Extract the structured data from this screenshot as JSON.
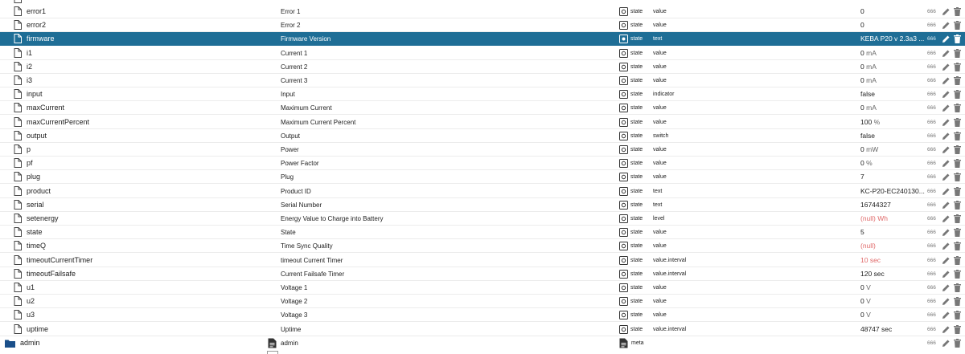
{
  "rows": [
    {
      "name": "error1",
      "label": "Error 1",
      "role": "state",
      "type": "value",
      "value": "0",
      "unit": "",
      "acl": "666"
    },
    {
      "name": "error2",
      "label": "Error 2",
      "role": "state",
      "type": "value",
      "value": "0",
      "unit": "",
      "acl": "666"
    },
    {
      "name": "firmware",
      "label": "Firmware Version",
      "role": "state",
      "type": "text",
      "value": "KEBA P20 v 2.3a3 ...",
      "unit": "",
      "acl": "666",
      "selected": true
    },
    {
      "name": "i1",
      "label": "Current 1",
      "role": "state",
      "type": "value",
      "value": "0",
      "unit": "mA",
      "acl": "666"
    },
    {
      "name": "i2",
      "label": "Current 2",
      "role": "state",
      "type": "value",
      "value": "0",
      "unit": "mA",
      "acl": "666"
    },
    {
      "name": "i3",
      "label": "Current 3",
      "role": "state",
      "type": "value",
      "value": "0",
      "unit": "mA",
      "acl": "666"
    },
    {
      "name": "input",
      "label": "Input",
      "role": "state",
      "type": "indicator",
      "value": "false",
      "unit": "",
      "acl": "666"
    },
    {
      "name": "maxCurrent",
      "label": "Maximum Current",
      "role": "state",
      "type": "value",
      "value": "0",
      "unit": "mA",
      "acl": "666"
    },
    {
      "name": "maxCurrentPercent",
      "label": "Maximum Current Percent",
      "role": "state",
      "type": "value",
      "value": "100",
      "unit": "%",
      "acl": "666"
    },
    {
      "name": "output",
      "label": "Output",
      "role": "state",
      "type": "switch",
      "value": "false",
      "unit": "",
      "acl": "666"
    },
    {
      "name": "p",
      "label": "Power",
      "role": "state",
      "type": "value",
      "value": "0",
      "unit": "mW",
      "acl": "666"
    },
    {
      "name": "pf",
      "label": "Power Factor",
      "role": "state",
      "type": "value",
      "value": "0",
      "unit": "%",
      "acl": "666"
    },
    {
      "name": "plug",
      "label": "Plug",
      "role": "state",
      "type": "value",
      "value": "7",
      "unit": "",
      "acl": "666"
    },
    {
      "name": "product",
      "label": "Product ID",
      "role": "state",
      "type": "text",
      "value": "KC-P20-EC240130...",
      "unit": "",
      "acl": "666"
    },
    {
      "name": "serial",
      "label": "Serial Number",
      "role": "state",
      "type": "text",
      "value": "16744327",
      "unit": "",
      "acl": "666"
    },
    {
      "name": "setenergy",
      "label": "Energy Value to Charge into Battery",
      "role": "state",
      "type": "level",
      "value": "(null) Wh",
      "unit": "",
      "acl": "666",
      "red": true
    },
    {
      "name": "state",
      "label": "State",
      "role": "state",
      "type": "value",
      "value": "5",
      "unit": "",
      "acl": "666"
    },
    {
      "name": "timeQ",
      "label": "Time Sync Quality",
      "role": "state",
      "type": "value",
      "value": "(null)",
      "unit": "",
      "acl": "666",
      "red": true
    },
    {
      "name": "timeoutCurrentTimer",
      "label": "timeout Current Timer",
      "role": "state",
      "type": "value.interval",
      "value": "10 sec",
      "unit": "",
      "acl": "666",
      "red": true
    },
    {
      "name": "timeoutFailsafe",
      "label": "Current Failsafe Timer",
      "role": "state",
      "type": "value.interval",
      "value": "120 sec",
      "unit": "",
      "acl": "666"
    },
    {
      "name": "u1",
      "label": "Voltage 1",
      "role": "state",
      "type": "value",
      "value": "0",
      "unit": "V",
      "acl": "666"
    },
    {
      "name": "u2",
      "label": "Voltage 2",
      "role": "state",
      "type": "value",
      "value": "0",
      "unit": "V",
      "acl": "666"
    },
    {
      "name": "u3",
      "label": "Voltage 3",
      "role": "state",
      "type": "value",
      "value": "0",
      "unit": "V",
      "acl": "666"
    },
    {
      "name": "uptime",
      "label": "Uptime",
      "role": "state",
      "type": "value.interval",
      "value": "48747 sec",
      "unit": "",
      "acl": "666"
    }
  ],
  "folder": {
    "name": "admin",
    "label": "admin",
    "role": "meta",
    "acl": "666"
  },
  "icons": {
    "file": "file-icon",
    "state": "state-icon",
    "edit": "pencil-icon",
    "delete": "trash-icon",
    "folder": "folder-icon",
    "channel": "channel-icon",
    "meta": "meta-icon"
  },
  "colors": {
    "selected_bg": "#1f6e96",
    "error_value": "#e06a6a",
    "folder": "#1a4f8a"
  }
}
